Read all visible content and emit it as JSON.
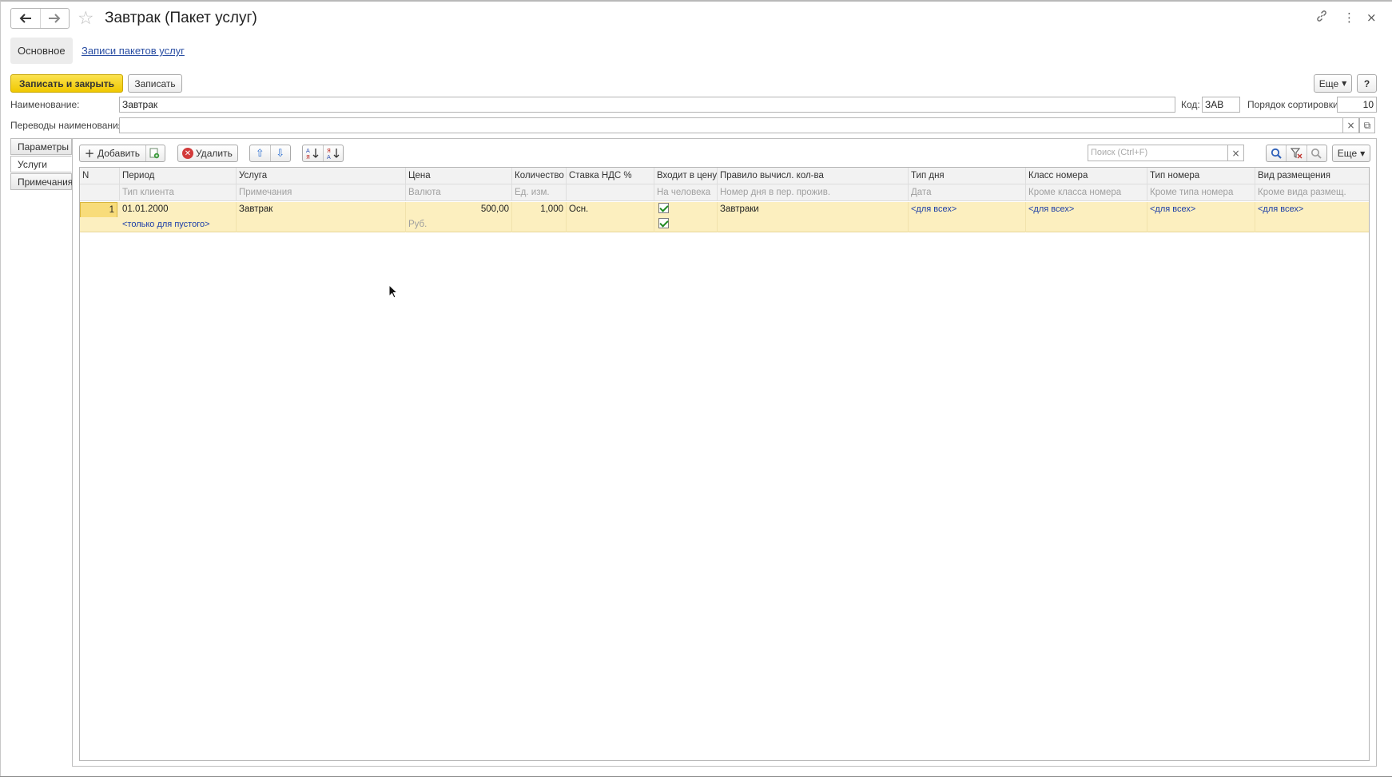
{
  "window": {
    "title": "Завтрак (Пакет услуг)"
  },
  "sections": {
    "main": "Основное",
    "records_link": "Записи пакетов услуг"
  },
  "commands": {
    "save_close": "Записать и закрыть",
    "save": "Записать",
    "more": "Еще",
    "help": "?"
  },
  "fields": {
    "name_label": "Наименование:",
    "name_value": "Завтрак",
    "code_label": "Код:",
    "code_value": "ЗАВ",
    "sort_label": "Порядок сортировки:",
    "sort_value": "10",
    "translations_label": "Переводы наименования:",
    "translations_value": ""
  },
  "page_tabs": [
    "Параметры",
    "Услуги",
    "Примечания"
  ],
  "table_toolbar": {
    "add": "Добавить",
    "delete": "Удалить",
    "search_placeholder": "Поиск (Ctrl+F)",
    "more": "Еще"
  },
  "table": {
    "header_top": [
      "N",
      "Период",
      "Услуга",
      "Цена",
      "Количество",
      "Ставка НДС %",
      "Входит в цену",
      "Правило вычисл. кол-ва",
      "Тип дня",
      "Класс номера",
      "Тип номера",
      "Вид размещения"
    ],
    "header_sub": [
      "",
      "Тип клиента",
      "Примечания",
      "Валюта",
      "Ед. изм.",
      "",
      "На человека",
      "Номер дня в пер. прожив.",
      "Дата",
      "Кроме класса номера",
      "Кроме типа номера",
      "Кроме вида размещ."
    ],
    "rows": [
      {
        "n": "1",
        "period": "01.01.2000",
        "service": "Завтрак",
        "price": "500,00",
        "quantity": "1,000",
        "vat": "Осн.",
        "included_in_price": true,
        "rule": "Завтраки",
        "day_type": "<для всех>",
        "room_class": "<для всех>",
        "room_type": "<для всех>",
        "accommodation": "<для всех>",
        "client_type": "<только для пустого>",
        "notes": "",
        "currency": "Руб.",
        "unit": "",
        "per_person": true,
        "day_number": "",
        "date": "",
        "except_class": "",
        "except_type": "",
        "except_accommodation": ""
      }
    ]
  }
}
